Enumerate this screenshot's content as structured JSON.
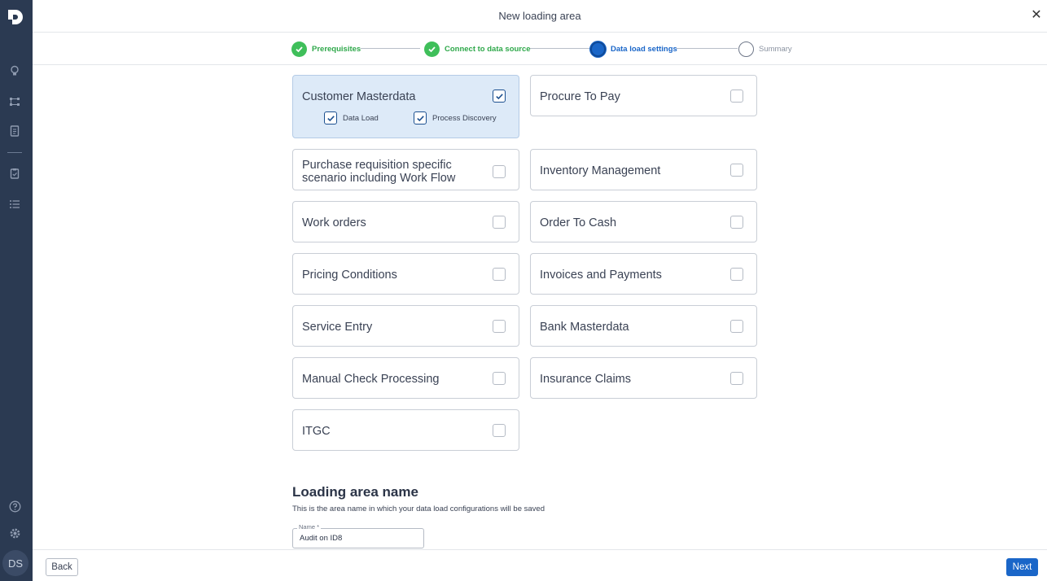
{
  "header": {
    "title": "New loading area"
  },
  "steps": [
    {
      "label": "Prerequisites",
      "state": "done"
    },
    {
      "label": "Connect to data source",
      "state": "done"
    },
    {
      "label": "Data load settings",
      "state": "active"
    },
    {
      "label": "Summary",
      "state": "pending"
    }
  ],
  "cards": [
    {
      "label": "Customer Masterdata",
      "checked": true,
      "sub": [
        {
          "label": "Data Load",
          "checked": true
        },
        {
          "label": "Process Discovery",
          "checked": true
        }
      ]
    },
    {
      "label": "Procure To Pay",
      "checked": false
    },
    {
      "label": "Purchase requisition specific scenario including Work Flow",
      "checked": false
    },
    {
      "label": "Inventory Management",
      "checked": false
    },
    {
      "label": "Work orders",
      "checked": false
    },
    {
      "label": "Order To Cash",
      "checked": false
    },
    {
      "label": "Pricing Conditions",
      "checked": false
    },
    {
      "label": "Invoices and Payments",
      "checked": false
    },
    {
      "label": "Service Entry",
      "checked": false
    },
    {
      "label": "Bank Masterdata",
      "checked": false
    },
    {
      "label": "Manual Check Processing",
      "checked": false
    },
    {
      "label": "Insurance Claims",
      "checked": false
    },
    {
      "label": "ITGC",
      "checked": false
    }
  ],
  "loading_area": {
    "title": "Loading area name",
    "description": "This is the area name in which your data load configurations will be saved",
    "name_label": "Name *",
    "name_value": "Audit on ID8"
  },
  "footer": {
    "back_label": "Back",
    "next_label": "Next"
  },
  "sidebar": {
    "avatar_initials": "DS",
    "icons": [
      "lightbulb-icon",
      "flow-icon",
      "document-icon",
      "clipboard-check-icon",
      "list-icon",
      "help-icon",
      "gear-icon"
    ]
  },
  "colors": {
    "accent": "#1a66c8",
    "success": "#3fbf5a",
    "sidebar": "#2b3a52",
    "selected_card": "#ddeaf8"
  }
}
